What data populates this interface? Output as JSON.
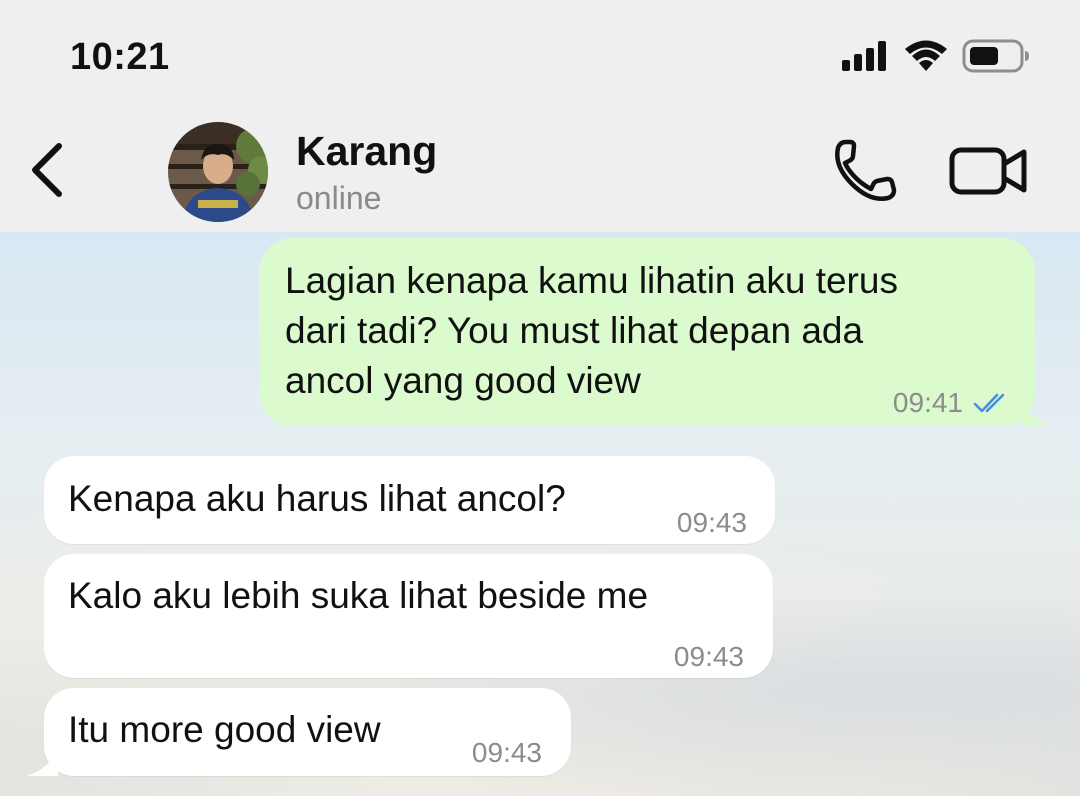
{
  "status_bar": {
    "time": "10:21",
    "icons": [
      "cellular-signal-icon",
      "wifi-icon",
      "battery-icon"
    ]
  },
  "header": {
    "back_icon": "chevron-left-icon",
    "contact_name": "Karang",
    "contact_status": "online",
    "actions": [
      "phone-icon",
      "video-camera-icon"
    ]
  },
  "colors": {
    "outgoing_bubble": "#dbfbcf",
    "incoming_bubble": "#ffffff",
    "read_receipt": "#4a8de0",
    "header_bg": "#efefef"
  },
  "messages": [
    {
      "direction": "outgoing",
      "lines": [
        "Lagian kenapa kamu lihatin aku terus",
        "dari tadi? You must lihat depan ada",
        "ancol yang good view"
      ],
      "time": "09:41",
      "status": "read"
    },
    {
      "direction": "incoming",
      "text": "Kenapa aku harus lihat ancol?",
      "time": "09:43"
    },
    {
      "direction": "incoming",
      "text": "Kalo aku lebih suka lihat beside me",
      "time": "09:43"
    },
    {
      "direction": "incoming",
      "text": "Itu more good view",
      "time": "09:43"
    }
  ]
}
